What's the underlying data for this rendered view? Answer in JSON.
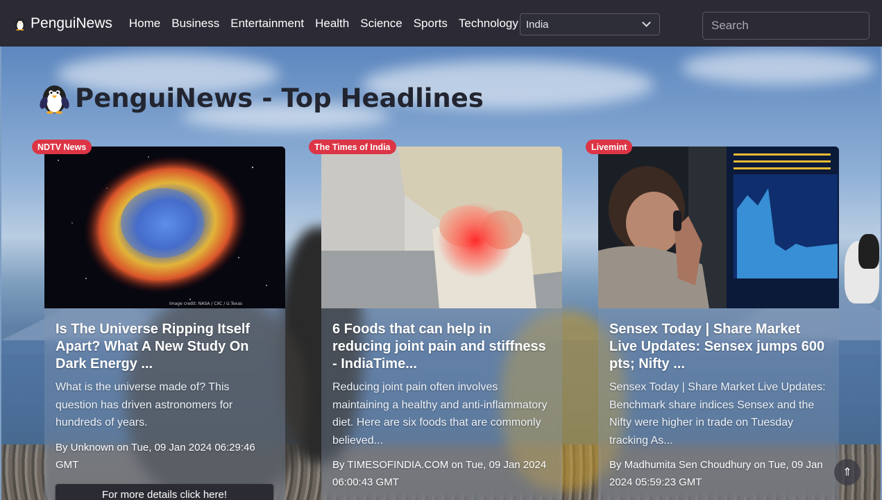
{
  "navbar": {
    "brand": "PenguiNews",
    "links": [
      "Home",
      "Business",
      "Entertainment",
      "Health",
      "Science",
      "Sports",
      "Technology"
    ],
    "country_selected": "India",
    "search_placeholder": "Search"
  },
  "page": {
    "heading": "PenguiNews - Top Headlines"
  },
  "articles": [
    {
      "source": "NDTV News",
      "title": "Is The Universe Ripping Itself Apart? What A New Study On Dark Energy ...",
      "description": "What is the universe made of? This question has driven astronomers for hundreds of years.",
      "meta": "By Unknown on Tue, 09 Jan 2024 06:29:46 GMT",
      "button": "For more details click here!",
      "image_credit": "Image credit: NASA / CXC / U.Texas"
    },
    {
      "source": "The Times of India",
      "title": "6 Foods that can help in reducing joint pain and stiffness - IndiaTime...",
      "description": "Reducing joint pain often involves maintaining a healthy and anti-inflammatory diet. Here are six foods that are commonly believed...",
      "meta": "By TIMESOFINDIA.COM on Tue, 09 Jan 2024 06:00:43 GMT"
    },
    {
      "source": "Livemint",
      "title": "Sensex Today | Share Market Live Updates: Sensex jumps 600 pts; Nifty ...",
      "description": "Sensex Today | Share Market Live Updates: Benchmark share indices Sensex and the Nifty were higher in trade on Tuesday tracking As...",
      "meta": "By Madhumita Sen Choudhury on Tue, 09 Jan 2024 05:59:23 GMT"
    }
  ],
  "scroll_top_glyph": "⇑"
}
